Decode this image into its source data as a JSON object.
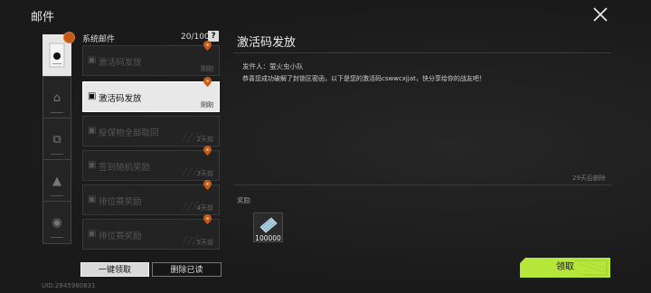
{
  "window": {
    "title": "邮件"
  },
  "categories": [
    {
      "icon": "system-mail-icon",
      "active": true
    },
    {
      "icon": "tag-icon",
      "active": false
    },
    {
      "icon": "dice-icon",
      "active": false
    },
    {
      "icon": "warning-triangle-icon",
      "active": false
    },
    {
      "icon": "helmet-icon",
      "active": false
    }
  ],
  "mail_list": {
    "title": "系统邮件",
    "count": "20/100",
    "help": "?",
    "items": [
      {
        "subject": "激活码发放",
        "age": "刚刚",
        "selected": false
      },
      {
        "subject": "激活码发放",
        "age": "刚刚",
        "selected": true
      },
      {
        "subject": "投保物全部取回",
        "age": "2天前",
        "selected": false
      },
      {
        "subject": "签到随机奖励",
        "age": "3天前",
        "selected": false
      },
      {
        "subject": "排位赛奖励",
        "age": "4天前",
        "selected": false
      },
      {
        "subject": "排位赛奖励",
        "age": "5天前",
        "selected": false
      }
    ],
    "claim_all_label": "一键领取",
    "delete_read_label": "删除已读"
  },
  "uid": "UID:2845980831",
  "detail": {
    "title": "激活码发放",
    "sender": "发件人：萤火虫小队",
    "body": "恭喜您成功破解了封锁区密函，以下是您的激活码cswwcxjjat，快分享给你的战友吧！",
    "expire": "29天后删除",
    "reward_label": "奖励",
    "reward_qty": "100000",
    "claim_label": "领取"
  },
  "colors": {
    "accent": "#b5e63a",
    "marker": "#c35a1b",
    "selected_bg": "#e8e8e8"
  }
}
